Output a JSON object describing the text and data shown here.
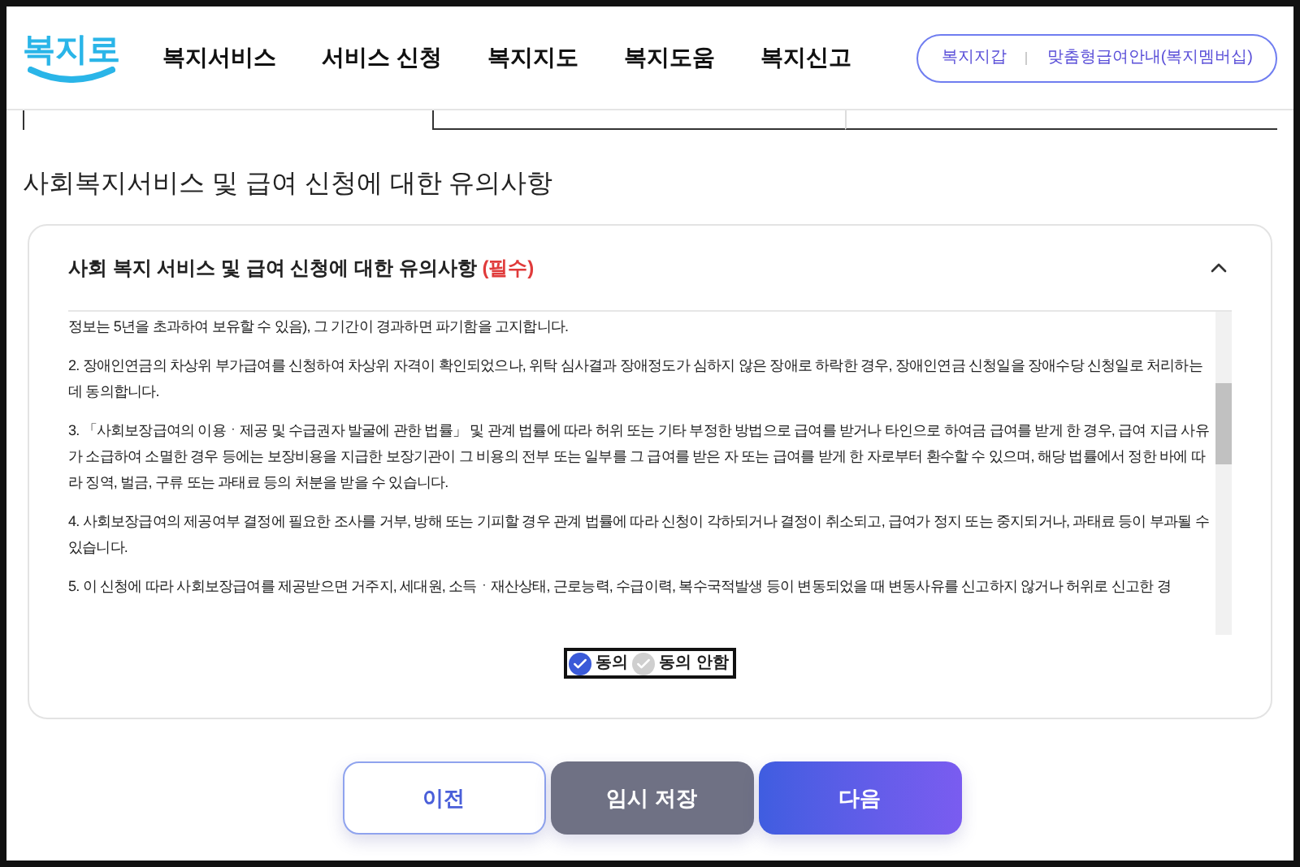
{
  "logo": {
    "text": "복지로"
  },
  "nav": [
    "복지서비스",
    "서비스 신청",
    "복지지도",
    "복지도움",
    "복지신고"
  ],
  "header_links": [
    "복지지갑",
    "맞춤형급여안내(복지멤버십)"
  ],
  "page_title": "사회복지서비스 및 급여 신청에 대한 유의사항",
  "section": {
    "title": "사회 복지 서비스 및 급여 신청에 대한 유의사항",
    "required": "(필수)",
    "expanded": true,
    "paragraphs": [
      "정보는 5년을 초과하여 보유할 수 있음), 그 기간이 경과하면 파기함을 고지합니다.",
      "2. 장애인연금의 차상위 부가급여를 신청하여 차상위 자격이 확인되었으나, 위탁 심사결과 장애정도가 심하지 않은 장애로 하락한 경우, 장애인연금 신청일을 장애수당 신청일로 처리하는데 동의합니다.",
      "3. 「사회보장급여의 이용ㆍ제공 및 수급권자 발굴에 관한 법률」 및 관계 법률에 따라 허위 또는 기타 부정한 방법으로 급여를 받거나 타인으로 하여금 급여를 받게 한 경우, 급여 지급 사유가 소급하여 소멸한 경우 등에는 보장비용을 지급한 보장기관이 그 비용의 전부 또는 일부를 그 급여를 받은 자 또는 급여를 받게 한 자로부터 환수할 수 있으며, 해당 법률에서 정한 바에 따라 징역, 벌금, 구류 또는 과태료 등의 처분을 받을 수 있습니다.",
      "4. 사회보장급여의 제공여부 결정에 필요한 조사를 거부, 방해 또는 기피할 경우 관계 법률에 따라 신청이 각하되거나 결정이 취소되고, 급여가 정지 또는 중지되거나, 과태료 등이 부과될 수 있습니다.",
      "5. 이 신청에 따라 사회보장급여를 제공받으면 거주지, 세대원, 소득ㆍ재산상태, 근로능력, 수급이력, 복수국적발생 등이 변동되었을 때 변동사유를 신고하지 않거나 허위로 신고한 경"
    ],
    "options": [
      {
        "label": "동의",
        "selected": true
      },
      {
        "label": "동의 안함",
        "selected": false
      }
    ]
  },
  "buttons": [
    {
      "label": "이전",
      "kind": "outline"
    },
    {
      "label": "임시 저장",
      "kind": "gray"
    },
    {
      "label": "다음",
      "kind": "primary"
    }
  ]
}
